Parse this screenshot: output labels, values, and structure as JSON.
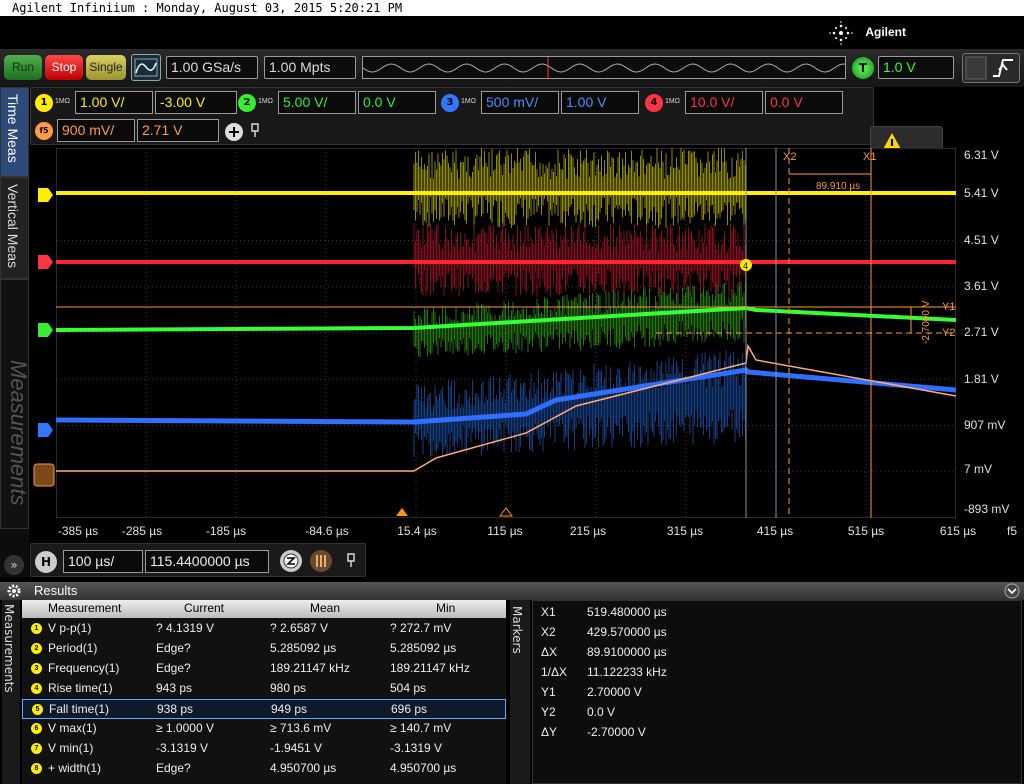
{
  "window": {
    "title": "Agilent Infiniium : Monday, August 03, 2015 5:20:21 PM",
    "brand": "Agilent"
  },
  "toolbar": {
    "run": "Run",
    "stop": "Stop",
    "single": "Single",
    "sample_rate": "1.00 GSa/s",
    "memory_depth": "1.00 Mpts",
    "trigger_label": "T",
    "trigger_level": "1.0 V"
  },
  "channels": [
    {
      "num": "1",
      "imp": "1MΩ",
      "scale": "1.00 V/",
      "offset": "-3.00 V",
      "color": "#ffee00"
    },
    {
      "num": "2",
      "imp": "1MΩ",
      "scale": "5.00 V/",
      "offset": "0.0 V",
      "color": "#33ee33"
    },
    {
      "num": "3",
      "imp": "1MΩ",
      "scale": "500 mV/",
      "offset": "1.00 V",
      "color": "#3377ff"
    },
    {
      "num": "4",
      "imp": "1MΩ",
      "scale": "10.0 V/",
      "offset": "0.0 V",
      "color": "#ff3344"
    }
  ],
  "func": {
    "num": "f5",
    "scale": "900 mV/",
    "offset": "2.71 V",
    "color": "#ff9944"
  },
  "sidetabs": {
    "time": "Time Meas",
    "vertical": "Vertical Meas",
    "measurements": "Measurements"
  },
  "right_axis": [
    "6.31 V",
    "5.41 V",
    "4.51 V",
    "3.61 V",
    "2.71 V",
    "1.81 V",
    "907 mV",
    "7 mV",
    "-893 mV"
  ],
  "x_axis": [
    "-385 µs",
    "-285 µs",
    "-185 µs",
    "-84.6 µs",
    "15.4 µs",
    "115 µs",
    "215 µs",
    "315 µs",
    "415 µs",
    "515 µs",
    "615 µs"
  ],
  "x_axis_func": "f5",
  "cursors": {
    "x2": "X2",
    "x1": "X1",
    "delta": "89.910 µs",
    "y1": "Y1",
    "y2": "Y2",
    "dy": "-2.7000 V"
  },
  "marker_4": "4",
  "horizontal": {
    "label": "H",
    "scale": "100 µs/",
    "position": "115.4400000 µs"
  },
  "results": {
    "title": "Results",
    "tab": "Measurements",
    "headers": [
      "Measurement",
      "Current",
      "Mean",
      "Min"
    ],
    "rows": [
      {
        "n": "1",
        "name": "V p-p(1)",
        "current": "? 4.1319 V",
        "mean": "? 2.6587 V",
        "min": "? 272.7 mV"
      },
      {
        "n": "2",
        "name": "Period(1)",
        "current": "Edge?",
        "mean": "5.285092 µs",
        "min": "5.285092 µs"
      },
      {
        "n": "3",
        "name": "Frequency(1)",
        "current": "Edge?",
        "mean": "189.21147 kHz",
        "min": "189.21147 kHz"
      },
      {
        "n": "4",
        "name": "Rise time(1)",
        "current": "943 ps",
        "mean": "980 ps",
        "min": "504 ps"
      },
      {
        "n": "5",
        "name": "Fall time(1)",
        "current": "938 ps",
        "mean": "949 ps",
        "min": "696 ps"
      },
      {
        "n": "6",
        "name": "V max(1)",
        "current": "≥ 1.0000 V",
        "mean": "≥ 713.6 mV",
        "min": "≥ 140.7 mV"
      },
      {
        "n": "7",
        "name": "V min(1)",
        "current": "-3.1319 V",
        "mean": "-1.9451 V",
        "min": "-3.1319 V"
      },
      {
        "n": "8",
        "name": "+ width(1)",
        "current": "Edge?",
        "mean": "4.950700 µs",
        "min": "4.950700 µs"
      }
    ]
  },
  "markers": {
    "tab": "Markers",
    "rows": [
      {
        "k": "X1",
        "v": "519.480000 µs"
      },
      {
        "k": "X2",
        "v": "429.570000 µs"
      },
      {
        "k": "ΔX",
        "v": "89.9100000 µs"
      },
      {
        "k": "1/ΔX",
        "v": "11.122233 kHz"
      },
      {
        "k": "Y1",
        "v": "2.70000 V"
      },
      {
        "k": "Y2",
        "v": "0.0 V"
      },
      {
        "k": "ΔY",
        "v": "-2.70000 V"
      }
    ]
  }
}
